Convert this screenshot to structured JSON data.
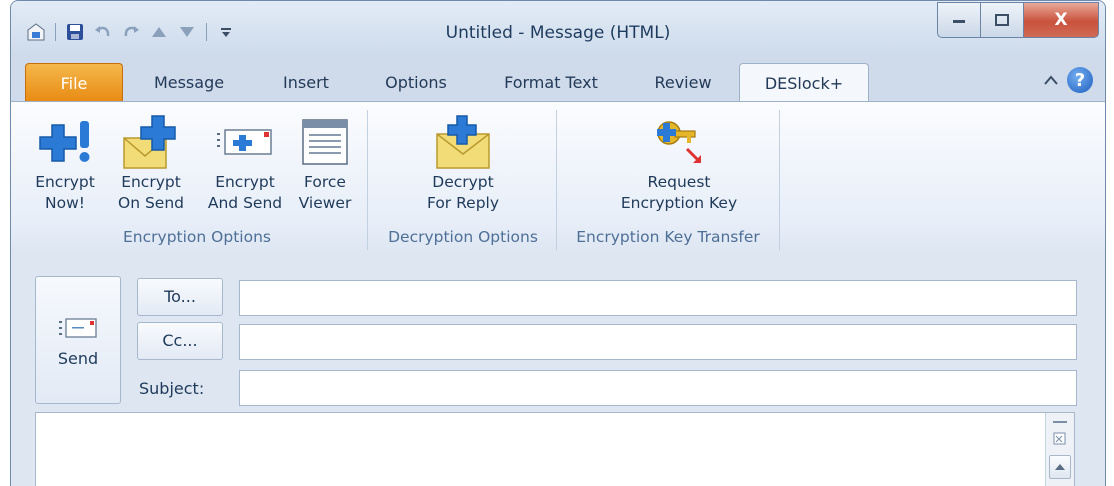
{
  "window": {
    "title": "Untitled  -  Message (HTML)",
    "close_glyph": "X"
  },
  "quick_access": [
    "outlook-icon",
    "save-icon",
    "undo-icon",
    "redo-icon",
    "up-arrow-icon",
    "down-arrow-icon",
    "customize-icon"
  ],
  "tabs": [
    "File",
    "Message",
    "Insert",
    "Options",
    "Format Text",
    "Review",
    "DESlock+"
  ],
  "active_tab": "DESlock+",
  "help_label": "?",
  "ribbon": {
    "groups": [
      {
        "name": "Encryption Options",
        "buttons": [
          {
            "line1": "Encrypt",
            "line2": "Now!",
            "icon": "encrypt-now-icon"
          },
          {
            "line1": "Encrypt",
            "line2": "On Send",
            "icon": "encrypt-on-send-icon"
          },
          {
            "line1": "Encrypt",
            "line2": "And Send",
            "icon": "encrypt-and-send-icon"
          },
          {
            "line1": "Force",
            "line2": "Viewer",
            "icon": "force-viewer-icon"
          }
        ]
      },
      {
        "name": "Decryption Options",
        "buttons": [
          {
            "line1": "Decrypt",
            "line2": "For Reply",
            "icon": "decrypt-for-reply-icon"
          }
        ]
      },
      {
        "name": "Encryption Key Transfer",
        "buttons": [
          {
            "line1": "Request",
            "line2": "Encryption Key",
            "icon": "request-key-icon"
          }
        ]
      }
    ]
  },
  "compose": {
    "send_label": "Send",
    "to_label": "To...",
    "cc_label": "Cc...",
    "subject_label": "Subject:",
    "to_value": "",
    "cc_value": "",
    "subject_value": ""
  },
  "colors": {
    "file_tab": "#e88a12",
    "accent": "#1e5fbf",
    "close_button": "#c9523c"
  }
}
